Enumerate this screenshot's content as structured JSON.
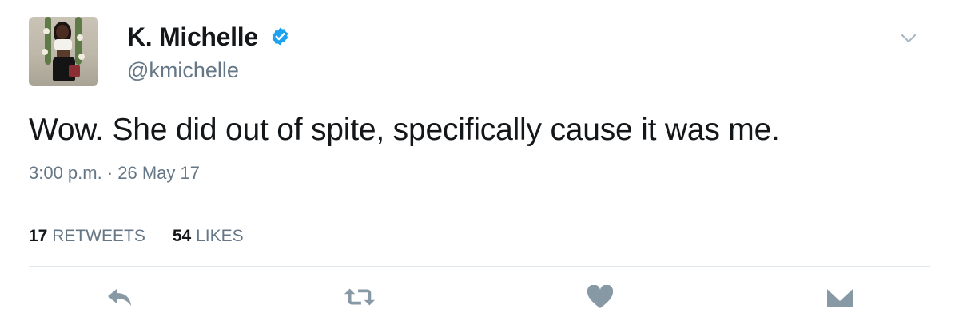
{
  "user": {
    "display_name": "K. Michelle",
    "handle": "@kmichelle",
    "verified": true
  },
  "tweet": {
    "text": "Wow. She did out of spite, specifically cause it was me.",
    "timestamp": "3:00 p.m. · 26 May 17"
  },
  "stats": {
    "retweets_count": "17",
    "retweets_label": "RETWEETS",
    "likes_count": "54",
    "likes_label": "LIKES"
  },
  "actions": [
    "reply-icon",
    "retweet-icon",
    "like-icon",
    "direct-message-icon"
  ],
  "colors": {
    "text_primary": "#14171a",
    "text_secondary": "#657786",
    "verified_blue": "#1da1f2",
    "icon_gray": "#8899a6",
    "divider": "#e1e8ed"
  }
}
